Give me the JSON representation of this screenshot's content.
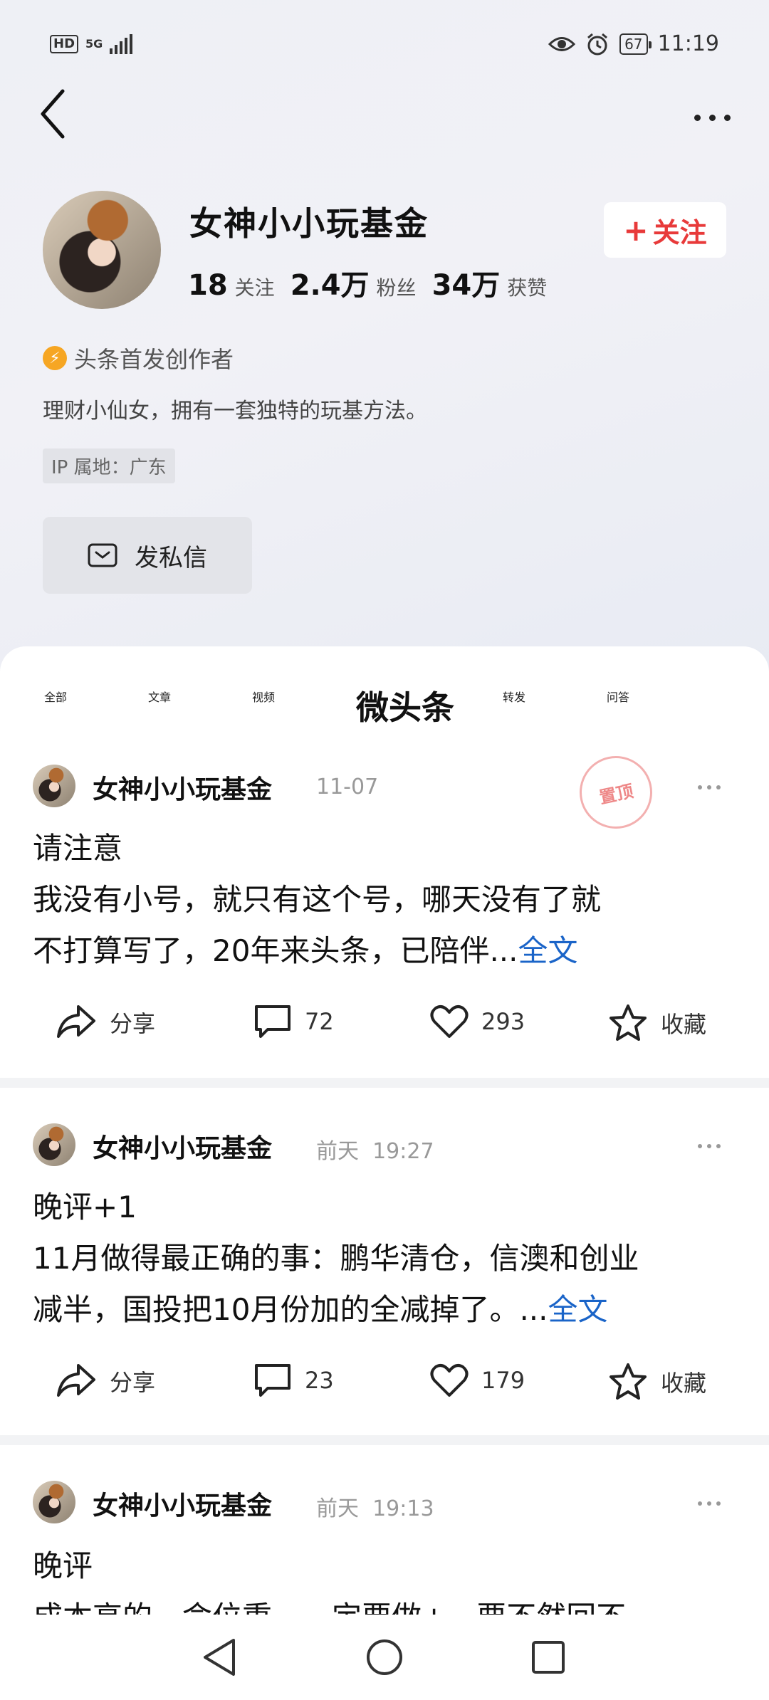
{
  "status_bar": {
    "hd": "HD",
    "network": "5G",
    "battery": "67",
    "time": "11:19"
  },
  "profile": {
    "name": "女神小小玩基金",
    "following_count": "18",
    "following_label": "关注",
    "fans_count": "2.4万",
    "fans_label": "粉丝",
    "likes_count": "34万",
    "likes_label": "获赞",
    "follow_button": "关注",
    "creator_badge": "头条首发创作者",
    "bio": "理财小仙女，拥有一套独特的玩基方法。",
    "ip_location": "IP 属地：广东",
    "message_button": "发私信"
  },
  "tabs": [
    "全部",
    "文章",
    "视频",
    "微头条",
    "转发",
    "问答"
  ],
  "active_tab": "微头条",
  "posts": [
    {
      "author": "女神小小玩基金",
      "time": "11-07",
      "pinned_label": "置顶",
      "line1": "请注意",
      "line2": "我没有小号，就只有这个号，哪天没有了就",
      "line3": "不打算写了，20年来头条，已陪伴...",
      "read_more": "全文",
      "share": "分享",
      "comments": "72",
      "likes": "293",
      "collect": "收藏"
    },
    {
      "author": "女神小小玩基金",
      "time": "前天  19:27",
      "line1": "晚评+1",
      "line2": "11月做得最正确的事：鹏华清仓，信澳和创业",
      "line3": "减半，国投把10月份加的全减掉了。...",
      "read_more": "全文",
      "share": "分享",
      "comments": "23",
      "likes": "179",
      "collect": "收藏"
    },
    {
      "author": "女神小小玩基金",
      "time": "前天  19:13",
      "line1": "晚评",
      "line2": "成本高的，命位重，一定要做+，要不然回不"
    }
  ]
}
